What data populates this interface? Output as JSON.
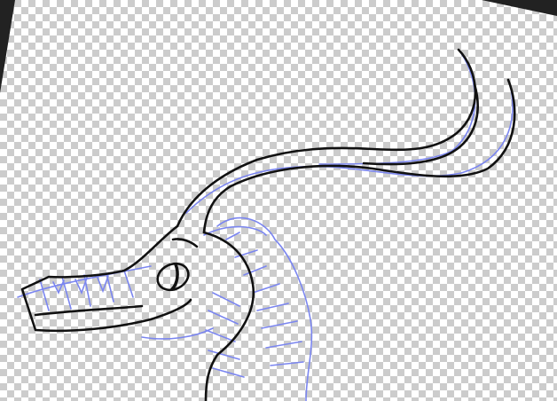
{
  "canvas": {
    "background_color": "#222222",
    "checker_light": "#ffffff",
    "checker_dark": "#cccccc",
    "sketch_color": "#7b86f0",
    "ink_color": "#111111"
  }
}
